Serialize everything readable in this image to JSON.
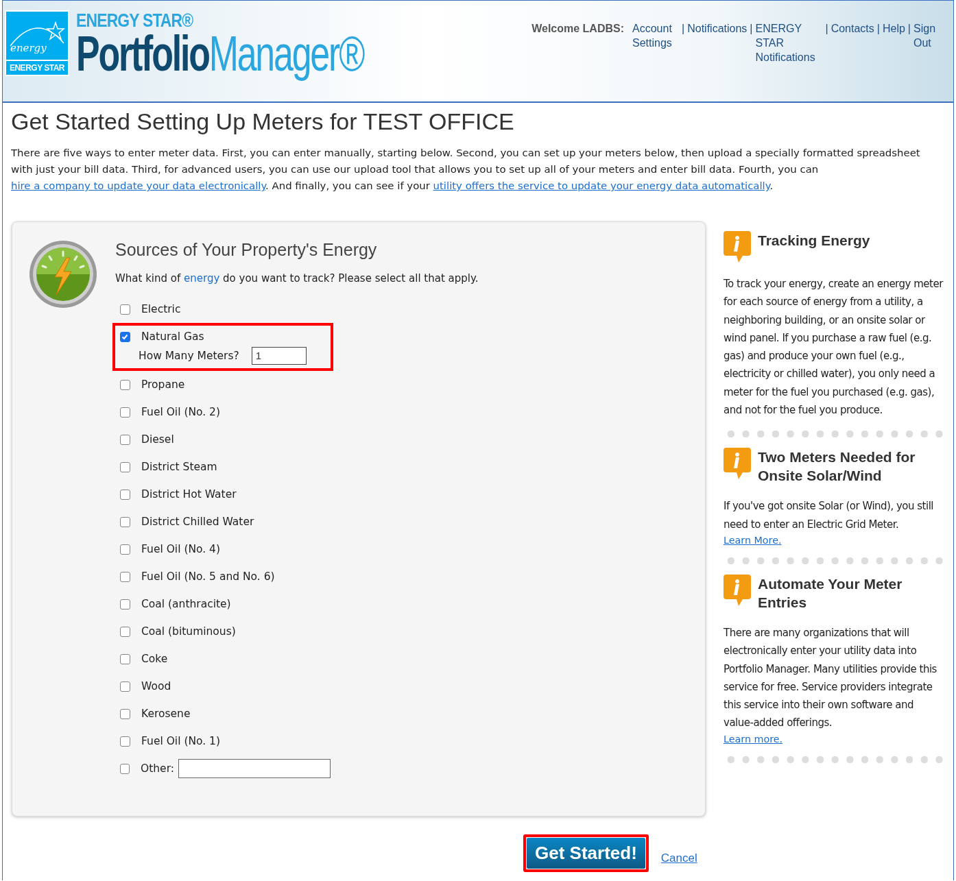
{
  "header": {
    "logo": {
      "script": "energy",
      "badge": "ENERGY STAR",
      "brand": "ENERGY STAR®",
      "product_dark": "Portfolio",
      "product_light": "Manager®"
    },
    "welcome": "Welcome LADBS:",
    "separator": "|",
    "nav_links": [
      {
        "label": "Account Settings"
      },
      {
        "label": "Notifications"
      },
      {
        "label": "ENERGY STAR Notifications"
      },
      {
        "label": "Contacts"
      },
      {
        "label": "Help"
      },
      {
        "label": "Sign Out"
      }
    ]
  },
  "page_title": "Get Started Setting Up Meters for TEST OFFICE",
  "intro": [
    {
      "text": "There are five ways to enter meter data. First, you can enter manually, starting below. Second, you can set up your meters below, then upload a specially formatted spreadsheet with just your bill data. Third, for advanced users, you can use our upload tool that allows you to set up all of your meters and enter bill data. Fourth, you can ",
      "link": false
    },
    {
      "text": "hire a company to update your data electronically",
      "link": true
    },
    {
      "text": ". And finally, you can see if your ",
      "link": false
    },
    {
      "text": "utility offers the service to update your energy data automatically",
      "link": true
    },
    {
      "text": ".",
      "link": false
    }
  ],
  "sources": {
    "title": "Sources of Your Property's Energy",
    "question": [
      {
        "text": "What kind of ",
        "link": false
      },
      {
        "text": "energy",
        "link": true
      },
      {
        "text": " do you want to track? Please select all that apply.",
        "link": false
      }
    ],
    "options": [
      {
        "label": "Electric",
        "checked": false,
        "highlighted": false
      },
      {
        "label": "Natural Gas",
        "checked": true,
        "highlighted": true,
        "meters": {
          "label": "How Many Meters?",
          "value": "1"
        }
      },
      {
        "label": "Propane",
        "checked": false,
        "highlighted": false
      },
      {
        "label": "Fuel Oil (No. 2)",
        "checked": false,
        "highlighted": false
      },
      {
        "label": "Diesel",
        "checked": false,
        "highlighted": false
      },
      {
        "label": "District Steam",
        "checked": false,
        "highlighted": false
      },
      {
        "label": "District Hot Water",
        "checked": false,
        "highlighted": false
      },
      {
        "label": "District Chilled Water",
        "checked": false,
        "highlighted": false
      },
      {
        "label": "Fuel Oil (No. 4)",
        "checked": false,
        "highlighted": false
      },
      {
        "label": "Fuel Oil (No. 5 and No. 6)",
        "checked": false,
        "highlighted": false
      },
      {
        "label": "Coal (anthracite)",
        "checked": false,
        "highlighted": false
      },
      {
        "label": "Coal (bituminous)",
        "checked": false,
        "highlighted": false
      },
      {
        "label": "Coke",
        "checked": false,
        "highlighted": false
      },
      {
        "label": "Wood",
        "checked": false,
        "highlighted": false
      },
      {
        "label": "Kerosene",
        "checked": false,
        "highlighted": false
      },
      {
        "label": "Fuel Oil (No. 1)",
        "checked": false,
        "highlighted": false
      },
      {
        "label": "Other:",
        "checked": false,
        "highlighted": false,
        "other_field": true
      }
    ]
  },
  "tips": [
    {
      "title": "Tracking Energy",
      "body": "To track your energy, create an energy meter for each source of energy from a utility, a neighboring building, or an onsite solar or wind panel. If you purchase a raw fuel (e.g. gas) and produce your own fuel (e.g., electricity or chilled water), you only need a meter for the fuel you purchased (e.g. gas), and not for the fuel you produce."
    },
    {
      "title": "Two Meters Needed for Onsite Solar/Wind",
      "body": "If you've got onsite Solar (or Wind), you still need to enter an Electric Grid Meter.",
      "link": "Learn More."
    },
    {
      "title": "Automate Your Meter Entries",
      "body": "There are many organizations that will electronically enter your utility data into Portfolio Manager. Many utilities provide this service for free. Service providers integrate this service into their own software and value-added offerings.",
      "link": "Learn more."
    }
  ],
  "actions": {
    "primary": {
      "label": "Get Started!",
      "highlighted": true
    },
    "cancel": "Cancel"
  }
}
